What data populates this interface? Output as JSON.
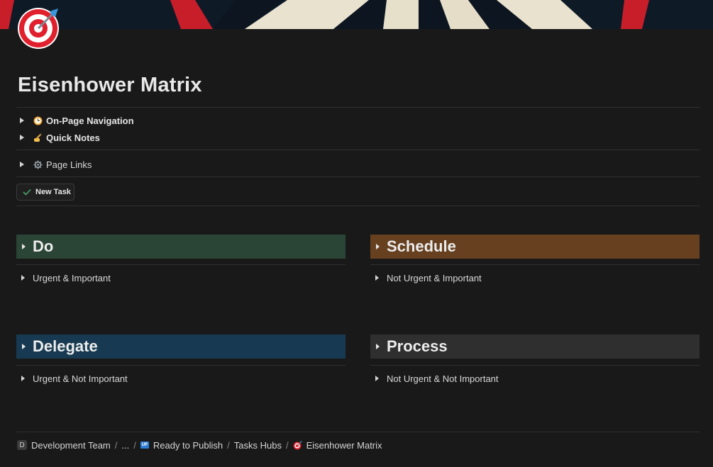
{
  "page": {
    "title": "Eisenhower Matrix",
    "icon": "target-dart-icon",
    "cover": "dartboard-cover"
  },
  "toggles": [
    {
      "label": "On-Page Navigation",
      "icon": "clock-icon"
    },
    {
      "label": "Quick Notes",
      "icon": "writing-hand-icon"
    }
  ],
  "page_links": {
    "label": "Page Links",
    "icon": "gear-icon"
  },
  "new_task": {
    "label": "New Task",
    "icon": "check-icon"
  },
  "quadrants": {
    "do": {
      "title": "Do",
      "item": "Urgent & Important",
      "color": "#2a4436"
    },
    "schedule": {
      "title": "Schedule",
      "item": "Not Urgent & Important",
      "color": "#66401f"
    },
    "delegate": {
      "title": "Delegate",
      "item": "Urgent & Not Important",
      "color": "#173a52"
    },
    "process": {
      "title": "Process",
      "item": "Not Urgent & Not Important",
      "color": "#2f2f2f"
    }
  },
  "breadcrumbs": {
    "workspace_badge": "D",
    "workspace": "Development Team",
    "ellipsis": "...",
    "ready_badge": "UP",
    "ready": "Ready to Publish",
    "hubs": "Tasks Hubs",
    "current": "Eisenhower Matrix",
    "separator": "/"
  }
}
